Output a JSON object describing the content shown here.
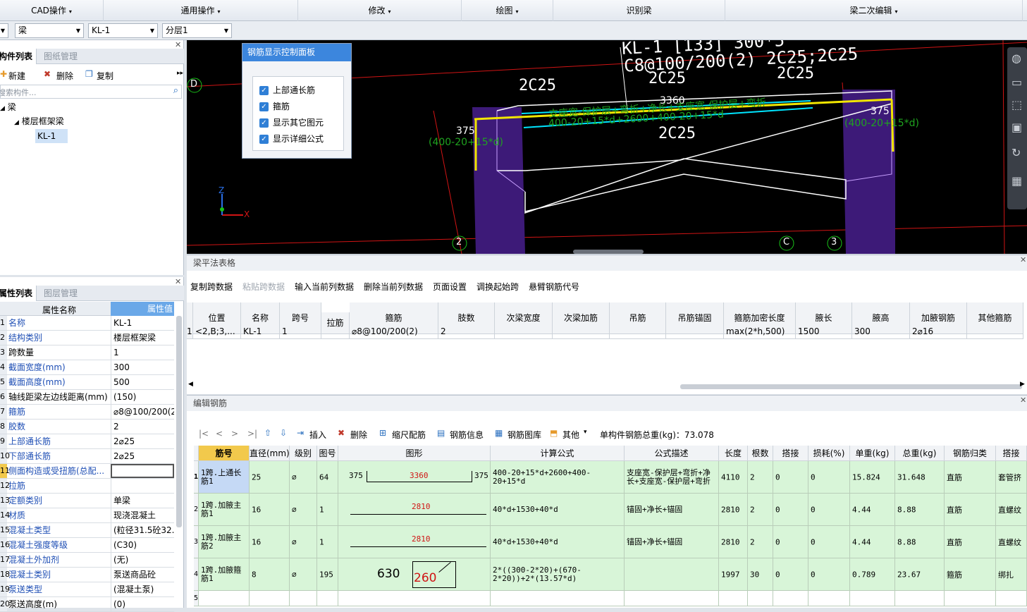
{
  "menubar": {
    "items": [
      {
        "label": "CAD操作",
        "caret": "▾"
      },
      {
        "label": "通用操作",
        "caret": "▾"
      },
      {
        "label": "修改",
        "caret": "▾"
      },
      {
        "label": "绘图",
        "caret": "▾"
      },
      {
        "label": "识别梁",
        "caret": ""
      },
      {
        "label": "梁二次编辑",
        "caret": "▾"
      }
    ]
  },
  "selectors": {
    "type": "梁",
    "member": "KL-1",
    "layer": "分层1"
  },
  "component_panel": {
    "tab_active": "构件列表",
    "tab_inactive": "图纸管理",
    "new_label": "新建",
    "delete_label": "删除",
    "copy_label": "复制",
    "search_placeholder": "搜索构件...",
    "tree": {
      "root": "梁",
      "group": "楼层框架梁",
      "leaf": "KL-1"
    }
  },
  "property_panel": {
    "tab_active": "属性列表",
    "tab_inactive": "图层管理",
    "col_name": "属性名称",
    "col_value": "属性值",
    "rows": [
      {
        "num": "1",
        "name": "名称",
        "value": "KL-1",
        "blue": true
      },
      {
        "num": "2",
        "name": "结构类别",
        "value": "楼层框架梁",
        "blue": true
      },
      {
        "num": "3",
        "name": "跨数量",
        "value": "1",
        "blue": false
      },
      {
        "num": "4",
        "name": "截面宽度(mm)",
        "value": "300",
        "blue": true
      },
      {
        "num": "5",
        "name": "截面高度(mm)",
        "value": "500",
        "blue": true
      },
      {
        "num": "6",
        "name": "轴线距梁左边线距离(mm)",
        "value": "(150)",
        "blue": false
      },
      {
        "num": "7",
        "name": "箍筋",
        "value": "⌀8@100/200(2)",
        "blue": true
      },
      {
        "num": "8",
        "name": "胶数",
        "value": "2",
        "blue": true
      },
      {
        "num": "9",
        "name": "上部通长筋",
        "value": "2⌀25",
        "blue": true
      },
      {
        "num": "10",
        "name": "下部通长筋",
        "value": "2⌀25",
        "blue": true
      },
      {
        "num": "11",
        "name": "侧面构造或受扭筋(总配...",
        "value": "",
        "blue": true
      },
      {
        "num": "12",
        "name": "拉筋",
        "value": "",
        "blue": true
      },
      {
        "num": "13",
        "name": "定额类别",
        "value": "单梁",
        "blue": true
      },
      {
        "num": "14",
        "name": "材质",
        "value": "现浇混凝土",
        "blue": true
      },
      {
        "num": "15",
        "name": "混凝土类型",
        "value": "(粒径31.5砼32.5",
        "blue": true
      },
      {
        "num": "16",
        "name": "混凝土强度等级",
        "value": "(C30)",
        "blue": true
      },
      {
        "num": "17",
        "name": "混凝土外加剂",
        "value": "(无)",
        "blue": true
      },
      {
        "num": "18",
        "name": "混凝土类别",
        "value": "泵送商品砼",
        "blue": true
      },
      {
        "num": "19",
        "name": "泵送类型",
        "value": "(混凝土泵)",
        "blue": true
      },
      {
        "num": "20",
        "name": "泵送高度(m)",
        "value": "(0)",
        "blue": false
      }
    ]
  },
  "control_panel": {
    "title": "钢筋显示控制面板",
    "options": [
      "上部通长筋",
      "箍筋",
      "显示其它图元",
      "显示详细公式"
    ]
  },
  "viewport": {
    "labels": {
      "beam_name": "KL-1 [133] 300*5",
      "stirrup": "C8@100/200(2) 2C25;2C25",
      "top_left": "2C25",
      "top_mid": "2C25",
      "top_right": "2C25",
      "bottom": "2C25",
      "length": "3360",
      "formula1": "支座宽-保护层+弯折+净长+支座宽-保护层+弯折",
      "formula2": "400-20+15*d+2600+400-20+15*d",
      "left_len": "375",
      "left_formula": "(400-20+15*d)",
      "right_len": "375",
      "right_formula": "(400-20+15*d)",
      "axis_d": "D",
      "axis_2": "2",
      "axis_c": "C",
      "axis_3": "3",
      "z": "Z",
      "x": "X"
    }
  },
  "beam_table": {
    "title": "梁平法表格",
    "toolbar": [
      "复制跨数据",
      "粘贴跨数据",
      "输入当前列数据",
      "删除当前列数据",
      "页面设置",
      "调换起始跨",
      "悬臂钢筋代号"
    ],
    "headers": [
      "位置",
      "名称",
      "跨号",
      "拉筋",
      "箍筋",
      "肢数",
      "次梁宽度",
      "次梁加筋",
      "吊筋",
      "吊筋锚固",
      "箍筋加密长度",
      "腋长",
      "腋高",
      "加腋钢筋",
      "其他箍筋"
    ],
    "row": {
      "num": "1",
      "pos": "<2,B;3,...",
      "name": "KL-1",
      "span": "1",
      "tie": "",
      "stirrup": "⌀8@100/200(2)",
      "legs": "2",
      "sec_w": "",
      "sec_add": "",
      "hang": "",
      "hang_anchor": "",
      "dense": "max(2*h,500)",
      "haunch_len": "1500",
      "haunch_h": "300",
      "haunch_bar": "2⌀16",
      "other": ""
    }
  },
  "rebar_editor": {
    "title": "编辑钢筋",
    "nav": [
      "|<",
      "<",
      ">",
      ">|"
    ],
    "toolbar": [
      "插入",
      "删除",
      "缩尺配筋",
      "钢筋信息",
      "钢筋图库",
      "其他"
    ],
    "weight_label": "单构件钢筋总重(kg)：73.078",
    "headers": [
      "筋号",
      "直径(mm)",
      "级别",
      "图号",
      "图形",
      "计算公式",
      "公式描述",
      "长度",
      "根数",
      "搭接",
      "损耗(%)",
      "单重(kg)",
      "总重(kg)",
      "钢筋归类",
      "搭接"
    ],
    "rows": [
      {
        "num": "1",
        "name": "1跨.上通长筋1",
        "dia": "25",
        "grade": "⌀",
        "fig": "64",
        "shape_left": "375",
        "shape_mid": "3360",
        "shape_right": "375",
        "formula": "400-20+15*d+2600+400-20+15*d",
        "desc": "支座宽-保护层+弯折+净长+支座宽-保护层+弯折",
        "len": "4110",
        "count": "2",
        "lap": "0",
        "loss": "0",
        "unit_w": "15.824",
        "total_w": "31.648",
        "cat": "直筋",
        "lap_type": "套管挤"
      },
      {
        "num": "2",
        "name": "1跨.加腋主筋1",
        "dia": "16",
        "grade": "⌀",
        "fig": "1",
        "shape_left": "",
        "shape_mid": "2810",
        "shape_right": "",
        "formula": "40*d+1530+40*d",
        "desc": "锚固+净长+锚固",
        "len": "2810",
        "count": "2",
        "lap": "0",
        "loss": "0",
        "unit_w": "4.44",
        "total_w": "8.88",
        "cat": "直筋",
        "lap_type": "直螺纹"
      },
      {
        "num": "3",
        "name": "1跨.加腋主筋2",
        "dia": "16",
        "grade": "⌀",
        "fig": "1",
        "shape_left": "",
        "shape_mid": "2810",
        "shape_right": "",
        "formula": "40*d+1530+40*d",
        "desc": "锚固+净长+锚固",
        "len": "2810",
        "count": "2",
        "lap": "0",
        "loss": "0",
        "unit_w": "4.44",
        "total_w": "8.88",
        "cat": "直筋",
        "lap_type": "直螺纹"
      },
      {
        "num": "4",
        "name": "1跨.加腋箍筋1",
        "dia": "8",
        "grade": "⌀",
        "fig": "195",
        "shape_left": "630",
        "shape_mid": "260",
        "shape_right": "",
        "formula": "2*((300-2*20)+(670-2*20))+2*(13.57*d)",
        "desc": "",
        "len": "1997",
        "count": "30",
        "lap": "0",
        "loss": "0",
        "unit_w": "0.789",
        "total_w": "23.67",
        "cat": "箍筋",
        "lap_type": "绑扎"
      }
    ],
    "empty_row_num": "5"
  },
  "colors": {
    "viewport_bg": "#000000",
    "column_purple": "#3d1a78",
    "rebar_yellow": "#f2e600",
    "rebar_cyan": "#00e5ff",
    "formula_green": "#1fa31f",
    "axis_green": "#19c219",
    "axis_red": "#d01414",
    "row_green": "#d8f5d8",
    "row_selected": "#c5d9f5"
  }
}
